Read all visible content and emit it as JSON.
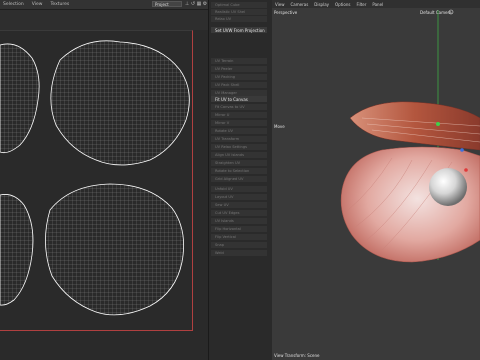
{
  "uv_editor": {
    "menu": [
      "Selection",
      "View",
      "Textures"
    ],
    "project_select": "Project",
    "toolbar_icons": [
      "lock-icon",
      "mirror-icon",
      "grid-icon",
      "settings-icon"
    ]
  },
  "command_panel": {
    "commands": [
      {
        "label": "Optimal Cube",
        "bright": false
      },
      {
        "label": "Realistic UV Shel",
        "bright": false
      },
      {
        "label": "Relax UV",
        "bright": false
      },
      {
        "label": "Set UVW From Projection",
        "bright": true
      },
      {
        "label": "UV Terrain",
        "bright": false
      },
      {
        "label": "UV Peeler",
        "bright": false
      },
      {
        "label": "UV Packing",
        "bright": false
      },
      {
        "label": "UV Pack Shell",
        "bright": false
      },
      {
        "label": "UV Manager",
        "bright": false
      },
      {
        "label": "Fit UV to Canvas",
        "bright": true
      },
      {
        "label": "Fit Canvas to UV",
        "bright": false
      },
      {
        "label": "Mirror U",
        "bright": false
      },
      {
        "label": "Mirror V",
        "bright": false
      },
      {
        "label": "Rotate UV",
        "bright": false
      },
      {
        "label": "UV Transform",
        "bright": false
      },
      {
        "label": "UV Relax Settings",
        "bright": false
      },
      {
        "label": "Align UV Islands",
        "bright": false
      },
      {
        "label": "Straighten UV",
        "bright": false
      },
      {
        "label": "Rotate to Selection",
        "bright": false
      },
      {
        "label": "Grid Aligned UV",
        "bright": false
      },
      {
        "label": "Unfold UV",
        "bright": false
      },
      {
        "label": "Layout UV",
        "bright": false
      },
      {
        "label": "Sew UV",
        "bright": false
      },
      {
        "label": "Cut UV Edges",
        "bright": false
      },
      {
        "label": "UV Islands",
        "bright": false
      },
      {
        "label": "Flip Horizontal",
        "bright": false
      },
      {
        "label": "Flip Vertical",
        "bright": false
      },
      {
        "label": "Snap",
        "bright": false
      },
      {
        "label": "Weld",
        "bright": false
      }
    ]
  },
  "viewport": {
    "menu": [
      "View",
      "Cameras",
      "Display",
      "Options",
      "Filter",
      "Panel"
    ],
    "label": "Perspective",
    "camera": "Default Camera",
    "axis_label": "Move",
    "status": "View Transform: Scene"
  },
  "colors": {
    "accent_green": "#3fd14a",
    "uv_frame_red": "#b04040",
    "shell_pink": "#e8b7b0",
    "pearl": "#dcdcdc"
  }
}
